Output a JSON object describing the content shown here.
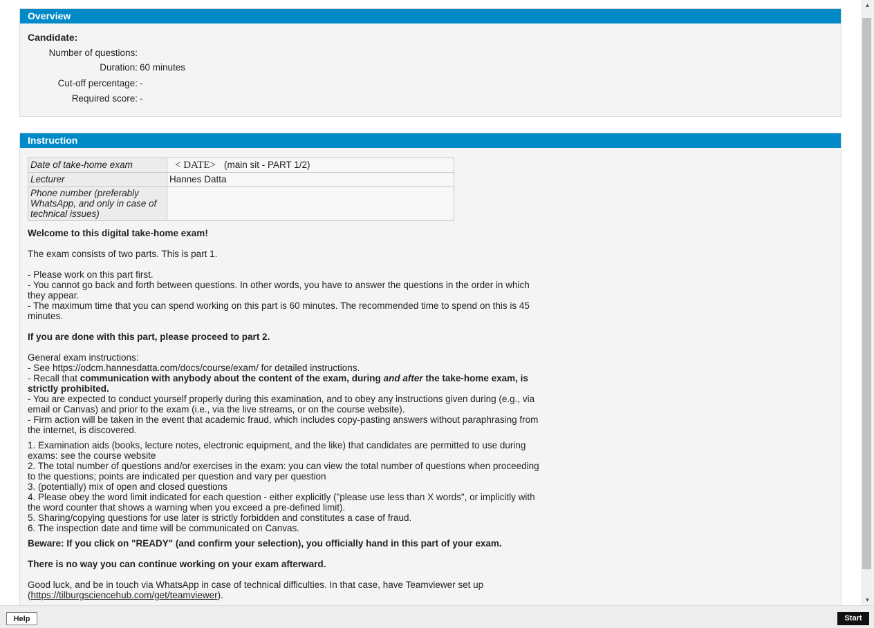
{
  "overview": {
    "header": "Overview",
    "candidate_label": "Candidate:",
    "rows": [
      {
        "label": "Number of questions:",
        "value": ""
      },
      {
        "label": "Duration:",
        "value": "60 minutes"
      },
      {
        "label": "Cut-off percentage:",
        "value": "-"
      },
      {
        "label": "Required score:",
        "value": "-"
      }
    ]
  },
  "instruction": {
    "header": "Instruction",
    "table": {
      "date_label": "Date of take-home exam",
      "date_placeholder": "< DATE>",
      "date_suffix": "(main sit - PART 1/2)",
      "lecturer_label": "Lecturer",
      "lecturer_value": "Hannes Datta",
      "phone_label": "Phone number (preferably WhatsApp, and only in case of technical issues)",
      "phone_value": ""
    },
    "welcome": "Welcome to this digital take-home exam!",
    "parts_intro": "The exam consists of two parts. This is part 1.",
    "part_rules": [
      "- Please work on this part first.",
      "- You cannot go back and forth between questions. In other words, you have to answer the questions in the order in which they appear.",
      "- The maximum time that you can spend working on this part is 60 minutes. The recommended time to spend on this is 45 minutes."
    ],
    "proceed": "If you are done with this part, please proceed to part 2.",
    "general_title": "General exam instructions:",
    "general_see": "- See https://odcm.hannesdatta.com/docs/course/exam/ for detailed instructions.",
    "recall_prefix": "- Recall that ",
    "recall_bold1": "communication with anybody about the content of the exam, during ",
    "recall_italic": "and after",
    "recall_bold2": " the take-home exam, is strictly prohibited.",
    "general_conduct": "- You are expected to conduct yourself properly during this examination, and to obey any instructions given during (e.g., via email or Canvas) and prior to the exam (i.e., via the live streams, or on the course website).",
    "general_fraud": "- Firm action will be taken in the event that academic fraud, which includes copy-pasting answers without paraphrasing from the internet, is discovered.",
    "numbered": [
      "1. Examination aids (books, lecture notes, electronic equipment, and the like) that candidates are permitted to use during exams: see the course website",
      "2. The total number of questions and/or exercises in the exam: you can view the total number of questions when proceeding to the questions; points are indicated per question and vary per question",
      "3. (potentially) mix of open and closed questions",
      "4. Please obey the word limit indicated for each question - either explicitly (\"please use less than X words\", or implicitly with the word counter that shows a warning when you exceed a pre-defined limit).",
      "5. Sharing/copying questions for use later is strictly forbidden and constitutes a case of fraud.",
      "6. The inspection date and time will be communicated on Canvas."
    ],
    "beware": "Beware: If you click on \"READY\" (and confirm your selection), you officially hand in this part of your exam.",
    "no_way": "There is no way you can continue working on your exam afterward.",
    "goodluck_text": "Good luck, and be in touch via WhatsApp in case of technical difficulties. In that case, have Teamviewer set up (",
    "goodluck_link": "https://tilburgsciencehub.com/get/teamviewer",
    "goodluck_end": ")."
  },
  "footer": {
    "help_label": "Help",
    "start_label": "Start"
  },
  "icons": {
    "scroll_up": "triangle-up",
    "scroll_down": "triangle-down"
  },
  "colors": {
    "header_bg": "#008ac7",
    "start_bg": "#111111"
  }
}
